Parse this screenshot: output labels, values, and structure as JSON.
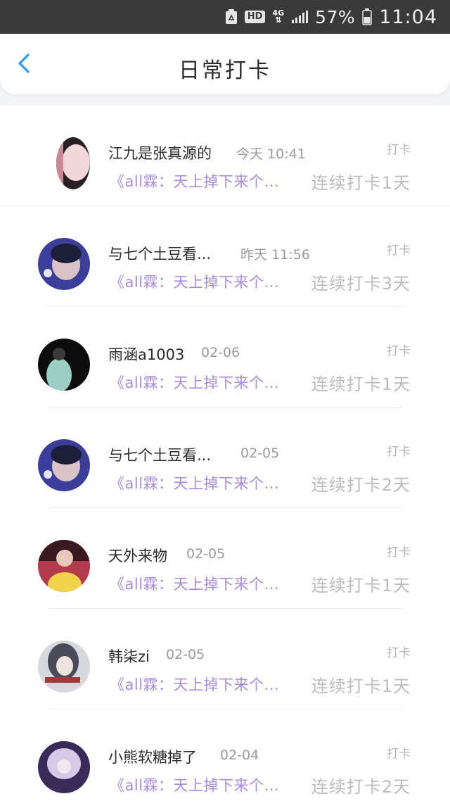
{
  "status_bar": {
    "hd_label": "HD",
    "network_label": "4G",
    "battery_text": "57%",
    "clock": "11:04"
  },
  "header": {
    "title": "日常打卡",
    "back_icon": "chevron-left-icon",
    "accent_color": "#2a9df4"
  },
  "items": [
    {
      "name": "江九是张真源的",
      "time": "今天 10:41",
      "tag": "打卡",
      "book": "《all霖：天上掉下来个...",
      "streak": "连续打卡1天",
      "avatar_colors": [
        "#f3d6d9",
        "#2a1f25"
      ]
    },
    {
      "name": "与七个土豆看...",
      "time": "昨天 11:56",
      "tag": "打卡",
      "book": "《all霖：天上掉下来个...",
      "streak": "连续打卡3天",
      "avatar_colors": [
        "#3b3f9a",
        "#d9c3c7"
      ]
    },
    {
      "name": "雨涵a1003",
      "time": "02-06",
      "tag": "打卡",
      "book": "《all霖：天上掉下来个...",
      "streak": "连续打卡1天",
      "avatar_colors": [
        "#0c0c0c",
        "#9ccfc4"
      ]
    },
    {
      "name": "与七个土豆看...",
      "time": "02-05",
      "tag": "打卡",
      "book": "《all霖：天上掉下来个...",
      "streak": "连续打卡2天",
      "avatar_colors": [
        "#3b3f9a",
        "#d9c3c7"
      ]
    },
    {
      "name": "天外来物",
      "time": "02-05",
      "tag": "打卡",
      "book": "《all霖：天上掉下来个...",
      "streak": "连续打卡1天",
      "avatar_colors": [
        "#b33a4a",
        "#f2d34a"
      ]
    },
    {
      "name": "韩柒zi",
      "time": "02-05",
      "tag": "打卡",
      "book": "《all霖：天上掉下来个...",
      "streak": "连续打卡1天",
      "avatar_colors": [
        "#d7d7de",
        "#4a4a5a"
      ]
    },
    {
      "name": "小熊软糖掉了",
      "time": "02-04",
      "tag": "打卡",
      "book": "《all霖：天上掉下来个...",
      "streak": "连续打卡2天",
      "avatar_colors": [
        "#3a2a5a",
        "#d8c8e8"
      ]
    }
  ]
}
